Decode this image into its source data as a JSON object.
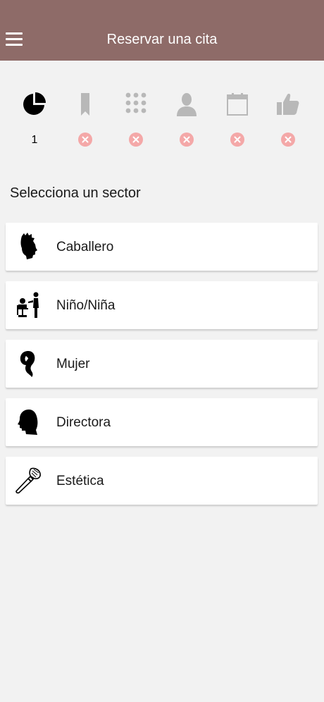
{
  "header": {
    "title": "Reservar una cita",
    "background_color": "#8e6b68",
    "menu_icon": "hamburger-menu-icon"
  },
  "steps": [
    {
      "icon": "pie-chart-icon",
      "label": "1",
      "status": "current",
      "color": "#000000"
    },
    {
      "icon": "bookmark-icon",
      "status": "incomplete",
      "color": "#b8b8b8"
    },
    {
      "icon": "grid-dots-icon",
      "status": "incomplete",
      "color": "#b8b8b8"
    },
    {
      "icon": "person-icon",
      "status": "incomplete",
      "color": "#b8b8b8"
    },
    {
      "icon": "calendar-icon",
      "status": "incomplete",
      "color": "#b8b8b8"
    },
    {
      "icon": "thumbs-up-icon",
      "status": "incomplete",
      "color": "#b8b8b8"
    }
  ],
  "status_badge_color": "#f4a8a8",
  "section": {
    "heading": "Selecciona un sector"
  },
  "sectors": [
    {
      "label": "Caballero",
      "icon": "man-head-icon"
    },
    {
      "label": "Niño/Niña",
      "icon": "barber-child-icon"
    },
    {
      "label": "Mujer",
      "icon": "woman-head-icon"
    },
    {
      "label": "Directora",
      "icon": "head-silhouette-icon"
    },
    {
      "label": "Estética",
      "icon": "makeup-brush-icon"
    }
  ]
}
